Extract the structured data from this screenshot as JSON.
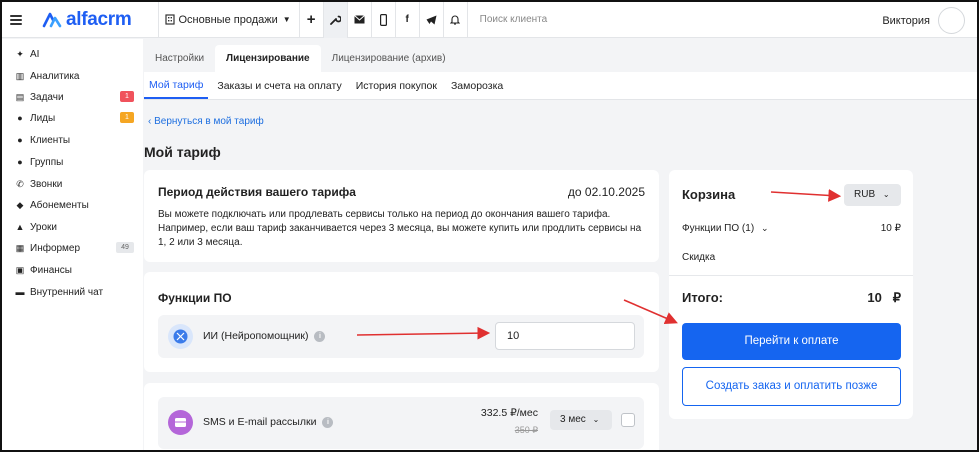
{
  "header": {
    "brand": "alfacrm",
    "branch": "Основные продажи",
    "search_placeholder": "Поиск клиента",
    "user_name": "Виктория",
    "toolbar_icons": [
      "plus-icon",
      "wrench-icon",
      "mail-icon",
      "phone-icon",
      "facebook-icon",
      "telegram-icon",
      "bell-icon"
    ]
  },
  "sidebar": {
    "items": [
      {
        "label": "AI",
        "icon": "sparkle-icon"
      },
      {
        "label": "Аналитика",
        "icon": "chart-icon"
      },
      {
        "label": "Задачи",
        "icon": "clipboard-icon",
        "badge": "1"
      },
      {
        "label": "Лиды",
        "icon": "user-plus-icon",
        "badge": "1"
      },
      {
        "label": "Клиенты",
        "icon": "user-icon"
      },
      {
        "label": "Группы",
        "icon": "group-icon"
      },
      {
        "label": "Звонки",
        "icon": "phone-icon"
      },
      {
        "label": "Абонементы",
        "icon": "tag-icon"
      },
      {
        "label": "Уроки",
        "icon": "cap-icon"
      },
      {
        "label": "Информер",
        "icon": "list-icon",
        "badge": "49"
      },
      {
        "label": "Финансы",
        "icon": "money-icon"
      },
      {
        "label": "Внутренний чат",
        "icon": "chat-icon"
      }
    ]
  },
  "tabs": {
    "top": [
      "Настройки",
      "Лицензирование",
      "Лицензирование (архив)"
    ],
    "sub": [
      "Мой тариф",
      "Заказы и счета на оплату",
      "История покупок",
      "Заморозка"
    ]
  },
  "back_link": "Вернуться в мой тариф",
  "page_title": "Мой тариф",
  "period_card": {
    "title": "Период действия вашего тарифа",
    "date": "до 02.10.2025",
    "text": "Вы можете подключать или продлевать сервисы только на период до окончания вашего тарифа. Например, если ваш тариф заканчивается через 3 месяца, вы можете купить или продлить сервисы на 1, 2 или 3 месяца."
  },
  "features_card": {
    "title": "Функции ПО",
    "item_label": "ИИ (Нейропомощник)",
    "quantity": "10"
  },
  "sms_card": {
    "label": "SMS и E-mail рассылки",
    "price": "332.5 ₽/мес",
    "old_price": "350 ₽",
    "period": "3 мес"
  },
  "cart": {
    "title": "Корзина",
    "currency": "RUB",
    "features_line": "Функции ПО (1)",
    "features_amount": "10 ₽",
    "discount_label": "Скидка",
    "total_label": "Итого:",
    "total_value": "10",
    "total_currency": "₽",
    "pay_button": "Перейти к оплате",
    "order_button": "Создать заказ и оплатить позже"
  },
  "colors": {
    "brand": "#1e5ef3",
    "primary_button": "#1565f0",
    "annotation_arrow": "#e03030",
    "ai_icon": "#3a7bea",
    "sms_icon": "#b466d9"
  }
}
